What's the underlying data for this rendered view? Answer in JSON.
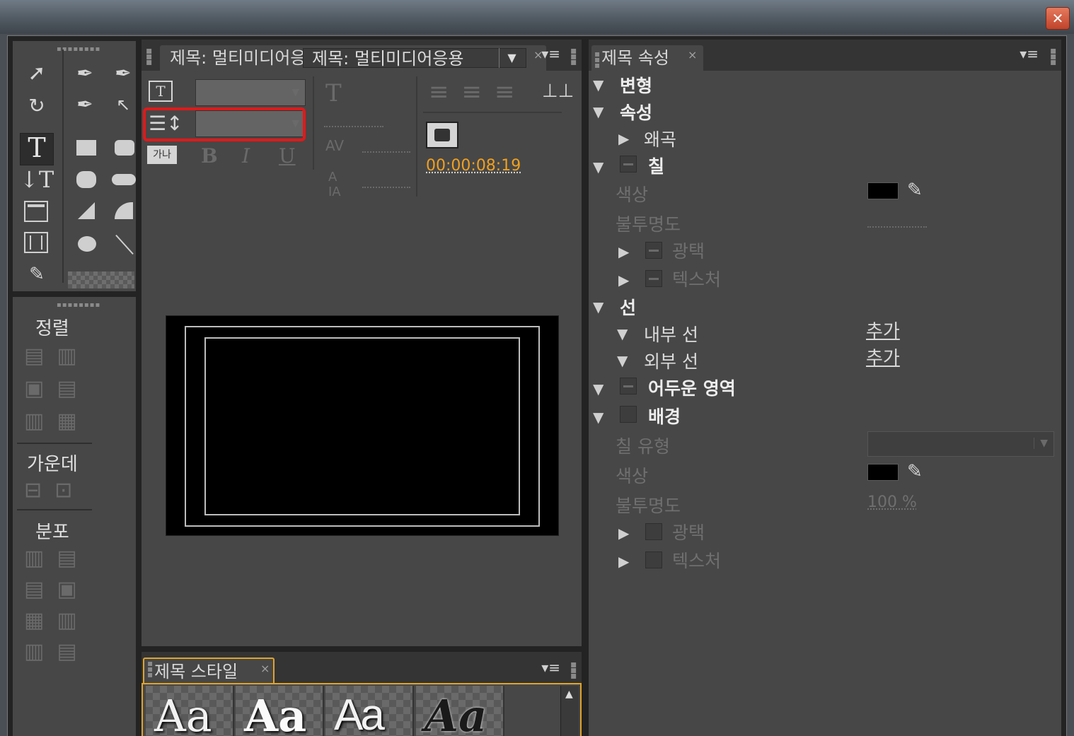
{
  "window": {
    "close_glyph": "✕"
  },
  "title_panel": {
    "tab_label": "제목: 멀티미디어응용",
    "close": "×",
    "menu_glyph": "▾≡",
    "timecode": "00:00:08:19",
    "timecode_color": "#f0a020",
    "highlight_color": "#e0191b"
  },
  "toolbox": {
    "align_label": "정렬",
    "center_label": "가운데",
    "distribute_label": "분포"
  },
  "properties_panel": {
    "tab_label": "제목 속성",
    "close": "×",
    "menu_glyph": "▾≡",
    "rows": {
      "transform": "변형",
      "properties": "속성",
      "distort": "왜곡",
      "fill": "칠",
      "fill_color": "색상",
      "fill_opacity": "불투명도",
      "fill_sheen": "광택",
      "fill_texture": "텍스처",
      "strokes": "선",
      "inner_stroke": "내부 선",
      "inner_stroke_add": "추가",
      "outer_stroke": "외부 선",
      "outer_stroke_add": "추가",
      "shadow": "어두운 영역",
      "background": "배경",
      "bg_fill_type": "칠 유형",
      "bg_color": "색상",
      "bg_opacity": "불투명도",
      "bg_opacity_value": "100 %",
      "bg_sheen": "광택",
      "bg_texture": "텍스처"
    }
  },
  "styles_panel": {
    "tab_label": "제목 스타일",
    "close": "×",
    "menu_glyph": "▾≡",
    "samples": [
      "Aa",
      "Aa",
      "Aa",
      "Aa"
    ]
  }
}
